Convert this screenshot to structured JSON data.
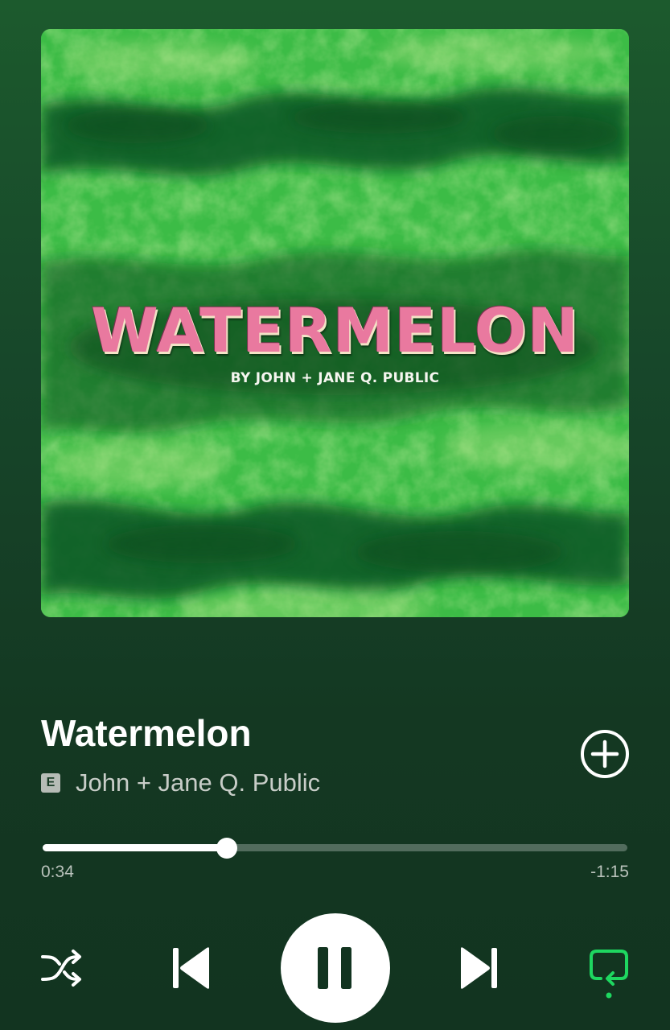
{
  "album_art": {
    "title": "WATERMELON",
    "subtitle": "BY JOHN + JANE Q. PUBLIC"
  },
  "track": {
    "title": "Watermelon",
    "explicit_badge": "E",
    "artist": "John + Jane Q. Public",
    "add_icon": "add-circle-icon"
  },
  "playback": {
    "elapsed": "0:34",
    "remaining": "-1:15",
    "progress_fraction": 0.315
  },
  "controls": {
    "shuffle_icon": "shuffle-icon",
    "previous_icon": "skip-previous-icon",
    "play_state_icon": "pause-icon",
    "next_icon": "skip-next-icon",
    "repeat_icon": "repeat-icon",
    "repeat_active": true
  },
  "colors": {
    "accent_green": "#1ed760",
    "background_top": "#1c5a2d",
    "background_bottom": "#123420"
  }
}
